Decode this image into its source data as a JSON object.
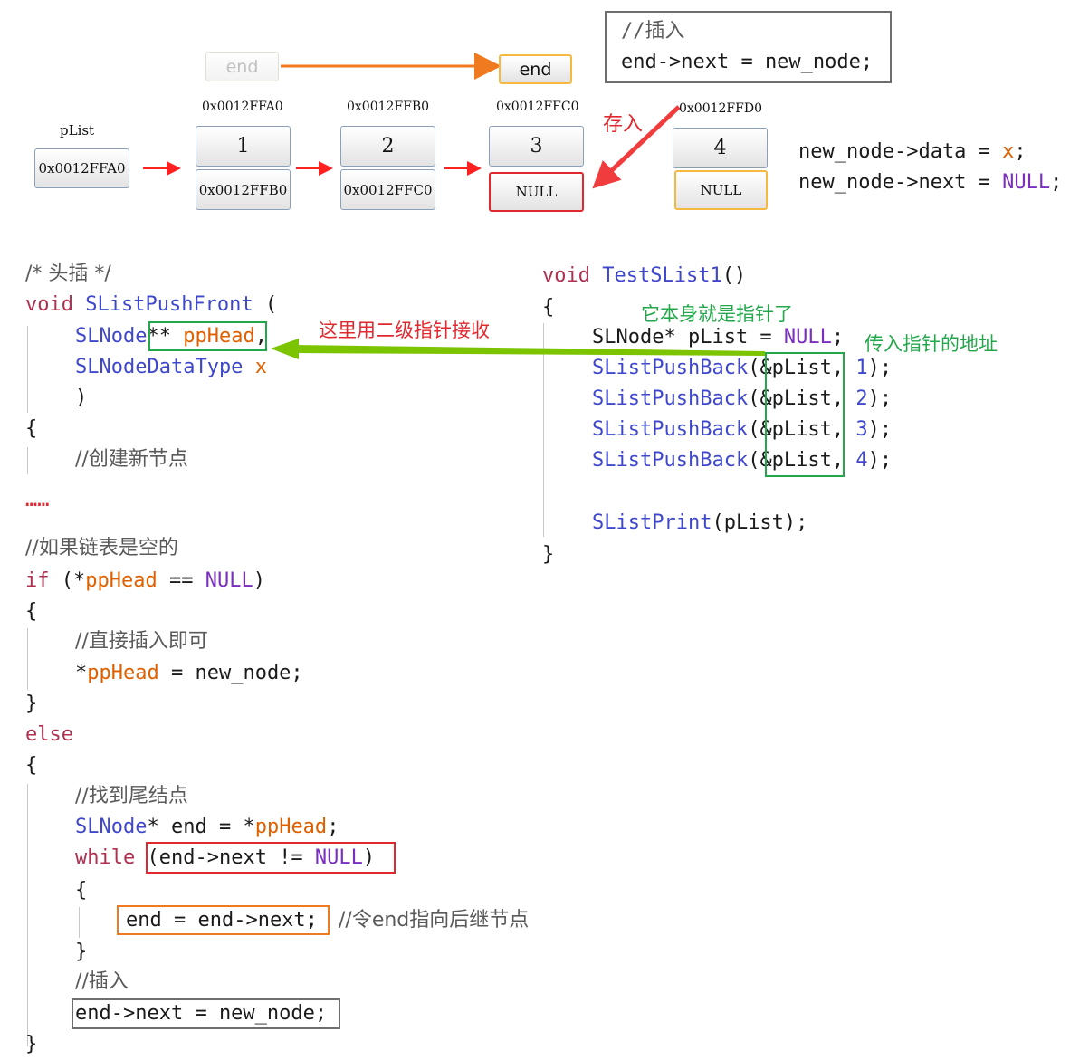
{
  "top_code_box": {
    "comment": "//插入",
    "line": "end->next = new_node;"
  },
  "end_ghost": "end",
  "end_current": "end",
  "plist": {
    "label": "pList",
    "value": "0x0012FFA0"
  },
  "nodes": [
    {
      "addr": "0x0012FFA0",
      "data": "1",
      "next": "0x0012FFB0"
    },
    {
      "addr": "0x0012FFB0",
      "data": "2",
      "next": "0x0012FFC0"
    },
    {
      "addr": "0x0012FFC0",
      "data": "3",
      "next": "NULL"
    },
    {
      "addr": "0x0012FFD0",
      "data": "4",
      "next": "NULL"
    }
  ],
  "store_label": "存入",
  "new_node_text": {
    "l1_a": "new_node->data = ",
    "l1_b": "x",
    "l1_c": ";",
    "l2_a": "new_node->next = ",
    "l2_b": "NULL",
    "l2_c": ";"
  },
  "left_code": {
    "c_head": "/* 头插 */",
    "kw_void": "void",
    "fn_name": "SListPushFront",
    "paren_open": " (",
    "t_slnode": "SLNode",
    "stars": "** ",
    "p_pphead": "ppHead",
    "comma": ",",
    "t_datatype": "SLNodeDataType",
    "p_x": "x",
    "paren_close": ")",
    "brace_open": "{",
    "c_create": "//创建新节点",
    "ellipsis": "……",
    "c_if_empty": "//如果链表是空的",
    "kw_if": "if",
    "if_open": " (*",
    "if_mid": " == ",
    "null": "NULL",
    "if_close": ")",
    "c_direct": "//直接插入即可",
    "star": "*",
    "assign_new": " = new_node;",
    "brace_close": "}",
    "kw_else": "else",
    "c_find_tail": "//找到尾结点",
    "end_decl_a": "* end = *",
    "semicolon": ";",
    "kw_while": "while",
    "while_a": "(end->next != ",
    "while_b": ")",
    "advance": "end = end->next;",
    "c_advance": "//令end指向后继节点",
    "c_insert": "//插入",
    "insert": "end->next = new_node;"
  },
  "right_code": {
    "kw_void": "void",
    "fn_name": "TestSList1",
    "parens": "()",
    "brace_open": "{",
    "decl_a": "SLNode* pList = ",
    "null": "NULL",
    "semicolon": ";",
    "push_calls": [
      {
        "fn": "SListPushBack",
        "open": "(",
        "arg": "&pList",
        "sep": ", ",
        "num": "1",
        "close": ");"
      },
      {
        "fn": "SListPushBack",
        "open": "(",
        "arg": "&pList",
        "sep": ", ",
        "num": "2",
        "close": ");"
      },
      {
        "fn": "SListPushBack",
        "open": "(",
        "arg": "&pList",
        "sep": ", ",
        "num": "3",
        "close": ");"
      },
      {
        "fn": "SListPushBack",
        "open": "(",
        "arg": "&pList",
        "sep": ", ",
        "num": "4",
        "close": ");"
      }
    ],
    "print_fn": "SListPrint",
    "print_args": "(pList);",
    "brace_close": "}"
  },
  "annotations": {
    "itself_pointer": "它本身就是指针了",
    "pass_address": "传入指针的地址",
    "double_pointer": "这里用二级指针接收"
  },
  "colors": {
    "red": "#e0282e",
    "green": "#22a84a",
    "orange": "#f07a20",
    "gray": "#6e6e6e",
    "lime": "#7cc400"
  }
}
